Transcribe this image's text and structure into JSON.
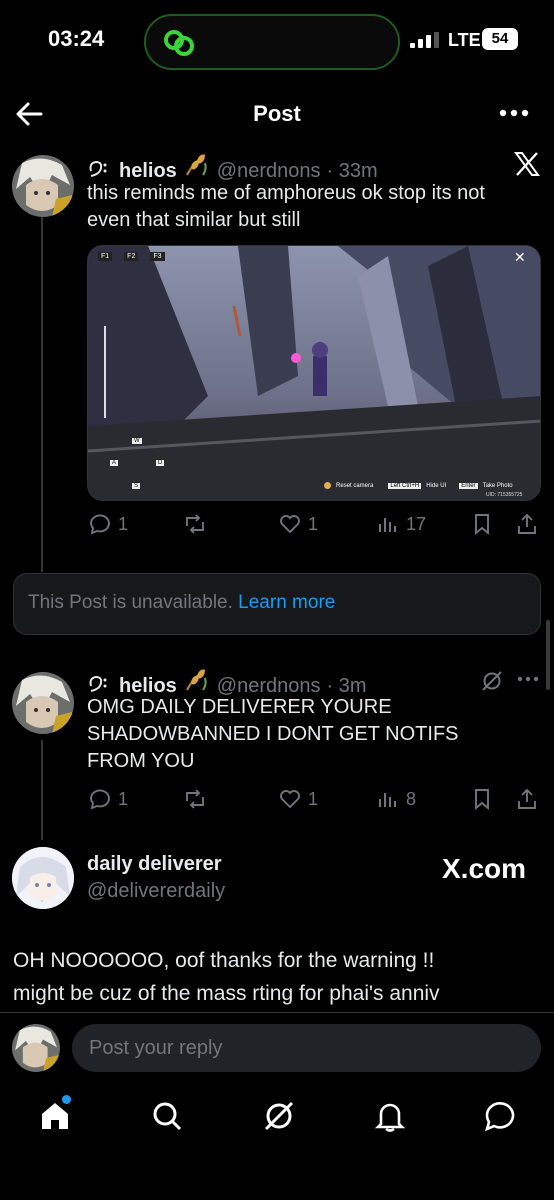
{
  "status_bar": {
    "time": "03:24",
    "network": "LTE",
    "battery": "54"
  },
  "header": {
    "title": "Post"
  },
  "post1": {
    "name": "helios",
    "handle": "@nerdnons",
    "time": "· 33m",
    "text_line1": "this reminds me of amphoreus ok stop its not",
    "text_line2": "even that similar but still",
    "media": {
      "hotkeys": [
        "F1",
        "F2",
        "F3"
      ],
      "move_keys": [
        "W",
        "A",
        "D",
        "S"
      ],
      "reset_camera": "Reset camera",
      "hide_key": "Left Ctrl+H",
      "hide_label": "Hide UI",
      "enter_key": "Enter",
      "photo_label": "Take Photo",
      "uid": "UID: 715355725",
      "close": "✕"
    },
    "replies": "1",
    "likes": "1",
    "views": "17"
  },
  "unavailable": {
    "text": "This Post is unavailable.",
    "link": "Learn more"
  },
  "post2": {
    "name": "helios",
    "handle": "@nerdnons",
    "time": "· 3m",
    "text_line1": "OMG DAILY DELIVERER YOURE",
    "text_line2": "SHADOWBANNED I DONT GET NOTIFS",
    "text_line3": "FROM YOU",
    "replies": "1",
    "likes": "1",
    "views": "8"
  },
  "post3": {
    "name": "daily deliverer",
    "handle": "@delivererdaily",
    "watermark": "X.com",
    "text_line1": "OH NOOOOOO, oof thanks for the warning !!",
    "text_line2": "might be cuz of the mass rting for phai's anniv"
  },
  "reply": {
    "placeholder": "Post your reply"
  },
  "icons": {
    "back": "arrow-left-icon",
    "more": "more-horizontal-icon",
    "x_logo": "x-logo-icon",
    "home": "home-icon",
    "search": "search-icon",
    "grok": "grok-icon",
    "notifications": "bell-icon",
    "messages": "message-icon"
  },
  "colors": {
    "accent": "#1d9bf0",
    "muted": "#71767b",
    "text": "#e7e9ea",
    "island_border": "#1f5a1f"
  }
}
